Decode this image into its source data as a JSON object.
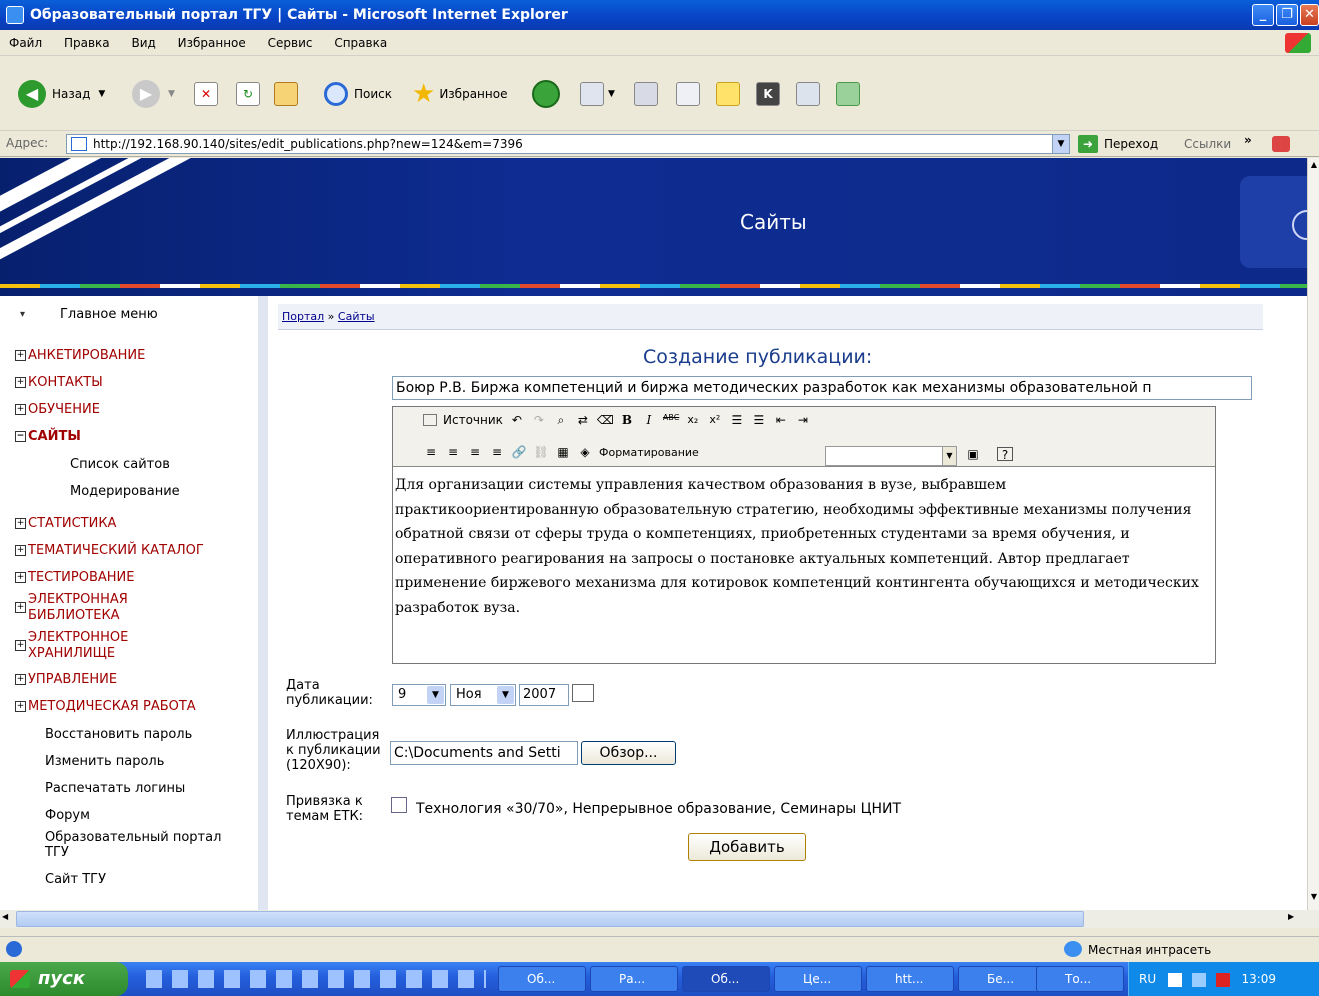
{
  "window": {
    "title": "Образовательный портал ТГУ | Сайты - Microsoft Internet Explorer"
  },
  "menu": [
    "Файл",
    "Правка",
    "Вид",
    "Избранное",
    "Сервис",
    "Справка"
  ],
  "toolbar": {
    "back": "Назад",
    "search": "Поиск",
    "favorites": "Избранное"
  },
  "address": {
    "label": "Адрес:",
    "url": "http://192.168.90.140/sites/edit_publications.php?new=124&em=7396",
    "go": "Переход",
    "links": "Ссылки"
  },
  "banner": {
    "title": "Сайты"
  },
  "sidebar": {
    "header": "Главное меню",
    "items": [
      "АНКЕТИРОВАНИЕ",
      "КОНТАКТЫ",
      "ОБУЧЕНИЕ",
      "САЙТЫ",
      "СТАТИСТИКА",
      "ТЕМАТИЧЕСКИЙ КАТАЛОГ",
      "ТЕСТИРОВАНИЕ",
      "ЭЛЕКТРОННАЯ БИБЛИОТЕКА",
      "ЭЛЕКТРОННОЕ ХРАНИЛИЩЕ",
      "УПРАВЛЕНИЕ",
      "МЕТОДИЧЕСКАЯ РАБОТА"
    ],
    "subitems": [
      "Список сайтов",
      "Модерирование"
    ],
    "links": [
      "Восстановить пароль",
      "Изменить пароль",
      "Распечатать логины",
      "Форум",
      "Образовательный портал ТГУ",
      "Сайт ТГУ"
    ]
  },
  "breadcrumb": {
    "portal": "Портал",
    "sep": " » ",
    "sites": "Сайты"
  },
  "form": {
    "heading": "Создание публикации:",
    "title_value": "Боюр Р.В. Биржа компетенций и биржа методических разработок как механизмы образовательной п",
    "editor": {
      "source": "Источник",
      "format": "Форматирование",
      "format_value": ""
    },
    "body": "Для организации системы управления качеством образования в вузе, выбравшем практикоориентированную образовательную стратегию, необходимы эффективные механизмы получения обратной связи от сферы труда о компетенциях, приобретенных студентами за время обучения, и оперативного реагирования на запросы о постановке актуальных компетенций. Автор предлагает применение биржевого механизма для котировок компетенций контингента обучающихся и методических разработок вуза.",
    "date_label": "Дата публикации:",
    "day": "9",
    "month": "Ноя",
    "year": "2007",
    "illustration_label": "Иллюстрация к публикации (120Х90):",
    "file_value": "C:\\Documents and Setti",
    "browse": "Обзор...",
    "topics_label": "Привязка к темам ЕТК:",
    "topics_value": "Технология «30/70», Непрерывное образование, Семинары ЦНИТ",
    "submit": "Добавить"
  },
  "status": {
    "zone": "Местная интрасеть"
  },
  "taskbar": {
    "start": "пуск",
    "tasks": [
      "Об...",
      "Ра...",
      "Об...",
      "Це...",
      "htt...",
      "Бе...",
      "То..."
    ],
    "lang": "RU",
    "time": "13:09"
  }
}
